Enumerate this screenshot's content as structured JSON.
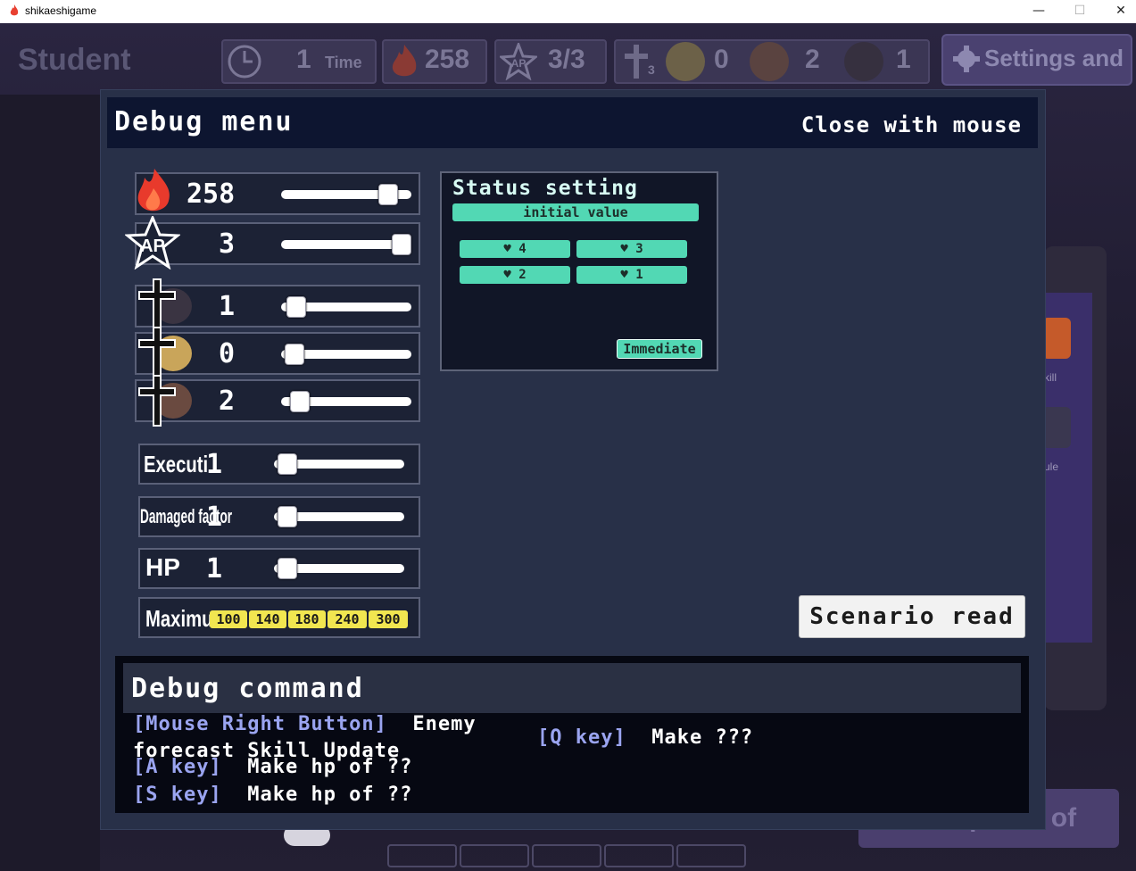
{
  "window": {
    "title": "shikaeshigame",
    "minimize_glyph": "—",
    "maximize_glyph": "☐",
    "close_glyph": "✕"
  },
  "hud": {
    "mode_label": "Student",
    "time_value": "1",
    "time_label": "Time",
    "fire_value": "258",
    "ap_value": "3/3",
    "cross_sub": "3",
    "char_a_count": "0",
    "char_b_count": "2",
    "char_c_count": "1",
    "settings_label": "Settings and"
  },
  "panel": {
    "title": "Debug menu",
    "close_text": "Close with mouse",
    "sliders": {
      "fire": {
        "value": "258",
        "level": 0.88
      },
      "ap": {
        "value": "3",
        "level": 1.0
      },
      "char_black": {
        "value": "1",
        "level": 0.05
      },
      "char_blonde": {
        "value": "0",
        "level": 0.03
      },
      "char_brown": {
        "value": "2",
        "level": 0.08
      },
      "execution": {
        "label": "Executi",
        "value": "1",
        "level": 0.03
      },
      "damaged": {
        "label": "Damaged factor",
        "value": "1",
        "level": 0.03
      },
      "hp": {
        "label": "HP",
        "value": "1",
        "level": 0.03
      }
    },
    "maximum": {
      "label": "Maximu",
      "options": [
        "100",
        "140",
        "180",
        "240",
        "300"
      ]
    },
    "status": {
      "title": "Status setting",
      "initial": "initial value",
      "hearts": [
        "♥ 4",
        "♥ 3",
        "♥ 2",
        "♥ 1"
      ],
      "immediate": "Immediate"
    },
    "scenario_button": "Scenario read"
  },
  "commands": {
    "title": "Debug command",
    "lines": [
      {
        "key": "[Mouse Right Button]",
        "text": "Enemy"
      },
      {
        "key": "",
        "text": "forecast Skill Update"
      },
      {
        "key": "[A key]",
        "text": "Make hp of ??"
      },
      {
        "key": "[S key]",
        "text": "Make hp of ??"
      },
      {
        "key": "[Q key]",
        "text": "Make ???"
      }
    ]
  },
  "background": {
    "side_label_1": "kill",
    "side_label_2": "ule",
    "bottom_text": "To the patrol of"
  },
  "colors": {
    "accent_teal": "#52d8b4",
    "panel_bg": "#283048",
    "key_blue": "#9aa4f0",
    "yellow": "#f1e650"
  }
}
